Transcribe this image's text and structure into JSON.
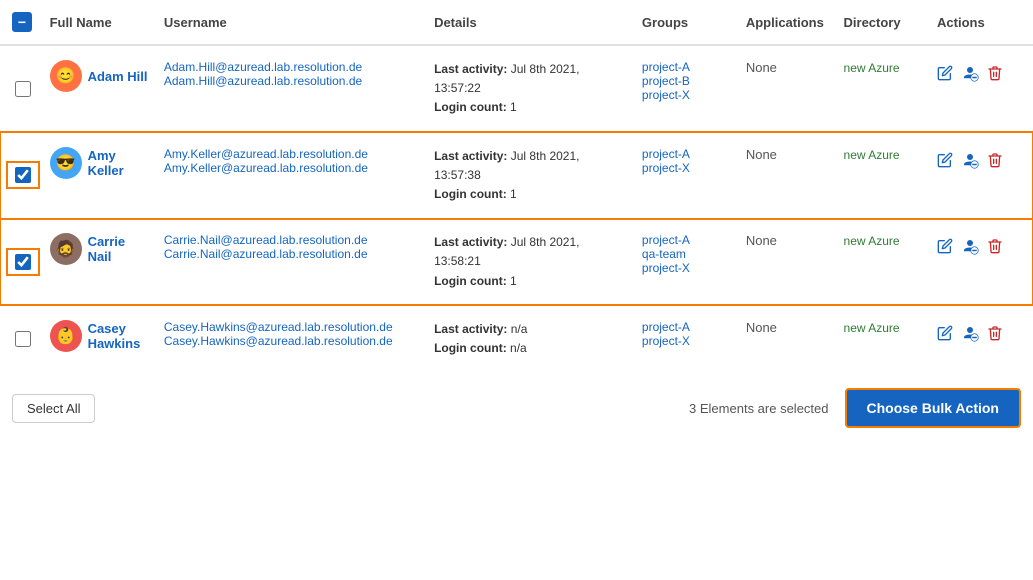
{
  "table": {
    "columns": [
      "Full Name",
      "Username",
      "Details",
      "Groups",
      "Applications",
      "Directory",
      "Actions"
    ],
    "rows": [
      {
        "id": "adam-hill",
        "checked": false,
        "avatar_emoji": "😊",
        "avatar_bg": "#ff7043",
        "full_name": "Adam Hill",
        "username_email1": "Adam.Hill@azuread.lab.resolution.de",
        "username_email2": "Adam.Hill@azuread.lab.resolution.de",
        "last_activity": "Last activity: Jul 8th 2021, 13:57:22",
        "login_count": "Login count: 1",
        "groups": [
          "project-A",
          "project-B",
          "project-X"
        ],
        "applications": "None",
        "directory": "new Azure",
        "selected": false
      },
      {
        "id": "amy-keller",
        "checked": true,
        "avatar_emoji": "😎",
        "avatar_bg": "#42a5f5",
        "full_name": "Amy Keller",
        "username_email1": "Amy.Keller@azuread.lab.resolution.de",
        "username_email2": "Amy.Keller@azuread.lab.resolution.de",
        "last_activity": "Last activity: Jul 8th 2021, 13:57:38",
        "login_count": "Login count: 1",
        "groups": [
          "project-A",
          "project-X"
        ],
        "applications": "None",
        "directory": "new Azure",
        "selected": true
      },
      {
        "id": "carrie-nail",
        "checked": true,
        "avatar_emoji": "🧔",
        "avatar_bg": "#8d6e63",
        "full_name": "Carrie Nail",
        "username_email1": "Carrie.Nail@azuread.lab.resolution.de",
        "username_email2": "Carrie.Nail@azuread.lab.resolution.de",
        "last_activity": "Last activity: Jul 8th 2021, 13:58:21",
        "login_count": "Login count: 1",
        "groups": [
          "project-A",
          "qa-team",
          "project-X"
        ],
        "applications": "None",
        "directory": "new Azure",
        "selected": true
      },
      {
        "id": "casey-hawkins",
        "checked": false,
        "avatar_emoji": "👶",
        "avatar_bg": "#ef5350",
        "full_name": "Casey Hawkins",
        "username_email1": "Casey.Hawkins@azuread.lab.resolution.de",
        "username_email2": "Casey.Hawkins@azuread.lab.resolution.de",
        "last_activity": "Last activity: n/a",
        "login_count": "Login count: n/a",
        "groups": [
          "project-A",
          "project-X"
        ],
        "applications": "None",
        "directory": "new Azure",
        "selected": false
      }
    ]
  },
  "footer": {
    "select_all_label": "Select All",
    "elements_selected": "3 Elements are selected",
    "bulk_action_label": "Choose Bulk Action"
  },
  "icons": {
    "edit": "✏",
    "block": "🚫",
    "delete": "🗑"
  }
}
